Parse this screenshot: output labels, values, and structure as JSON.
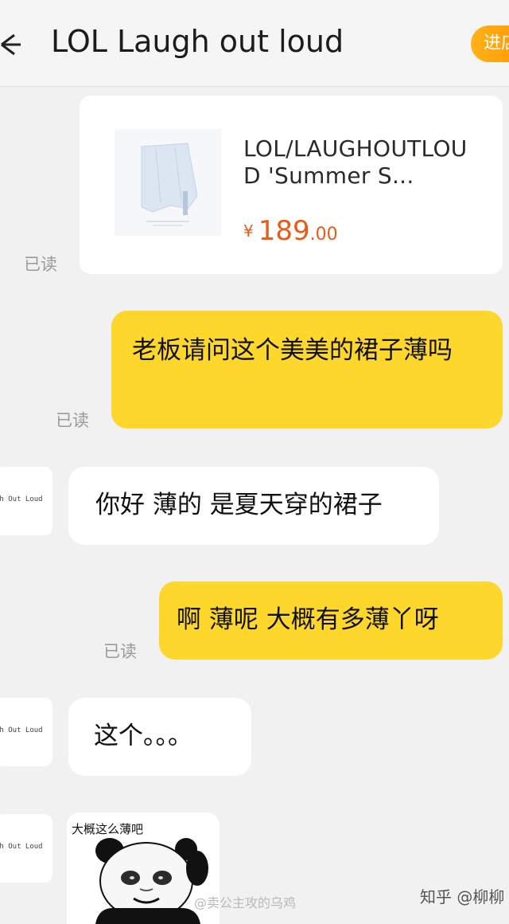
{
  "header": {
    "title": "LOL Laugh out loud",
    "enter_shop_label": "进店"
  },
  "product": {
    "name": "LOL/LAUGHOUTLOUD 'Summer S...",
    "price_symbol": "¥",
    "price_int": "189",
    "price_dec": ".00",
    "read_status": "已读"
  },
  "messages": [
    {
      "side": "right",
      "text": "老板请问这个美美的裙子薄吗",
      "read": "已读"
    },
    {
      "side": "left",
      "text": "你好 薄的 是夏天穿的裙子"
    },
    {
      "side": "right",
      "text": "啊 薄呢 大概有多薄丫呀",
      "read": "已读"
    },
    {
      "side": "left",
      "text": "这个。。。"
    }
  ],
  "avatar_text": "gh Out Loud",
  "sticker": {
    "caption": "大概这么薄吧"
  },
  "watermarks": {
    "left": "@卖公主攻的乌鸡",
    "right": "知乎 @柳柳"
  },
  "colors": {
    "outgoing_bubble": "#fed72c",
    "accent_orange": "#ff9800",
    "price": "#e85b17"
  }
}
